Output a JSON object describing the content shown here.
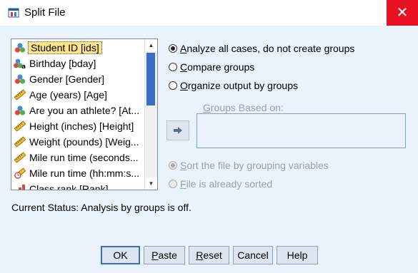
{
  "window": {
    "title": "Split File",
    "close_glyph": "✕"
  },
  "variables": [
    {
      "label": "Student ID [ids]",
      "icon": "nominal-icon",
      "selected": true
    },
    {
      "label": "Birthday [bday]",
      "icon": "string-nominal-icon"
    },
    {
      "label": "Gender [Gender]",
      "icon": "nominal-icon"
    },
    {
      "label": "Age (years) [Age]",
      "icon": "scale-ruler-icon"
    },
    {
      "label": "Are you an athlete? [At...",
      "icon": "nominal-icon"
    },
    {
      "label": "Height (inches) [Height]",
      "icon": "scale-ruler-icon"
    },
    {
      "label": "Weight (pounds) [Weig...",
      "icon": "scale-ruler-icon"
    },
    {
      "label": "Mile run time (seconds...",
      "icon": "scale-ruler-icon"
    },
    {
      "label": "Mile run time (hh:mm:s...",
      "icon": "scale-time-icon"
    },
    {
      "label": "Class rank [Rank]",
      "icon": "ordinal-icon"
    }
  ],
  "options": {
    "analyze_all": {
      "prefix": "A",
      "rest": "nalyze all cases, do not create groups",
      "checked": true
    },
    "compare": {
      "prefix": "C",
      "rest": "ompare groups",
      "checked": false
    },
    "organize": {
      "prefix": "O",
      "rest": "rganize output by groups",
      "checked": false
    }
  },
  "groups_based_on": {
    "prefix": "G",
    "rest": "roups Based on:"
  },
  "sort_options": {
    "sort_file": {
      "prefix": "S",
      "rest": "ort the file by grouping variables",
      "checked": true,
      "disabled": true
    },
    "already_sorted": {
      "prefix": "F",
      "rest": "ile is already sorted",
      "checked": false,
      "disabled": true
    }
  },
  "status": "Current Status: Analysis by groups is off.",
  "buttons": {
    "ok": "OK",
    "paste": {
      "prefix": "P",
      "rest": "aste"
    },
    "reset": {
      "prefix": "R",
      "rest": "eset"
    },
    "cancel": "Cancel",
    "help": "Help"
  },
  "colors": {
    "accent": "#3b6fb6",
    "close": "#e81123",
    "selection": "#fde48a"
  }
}
